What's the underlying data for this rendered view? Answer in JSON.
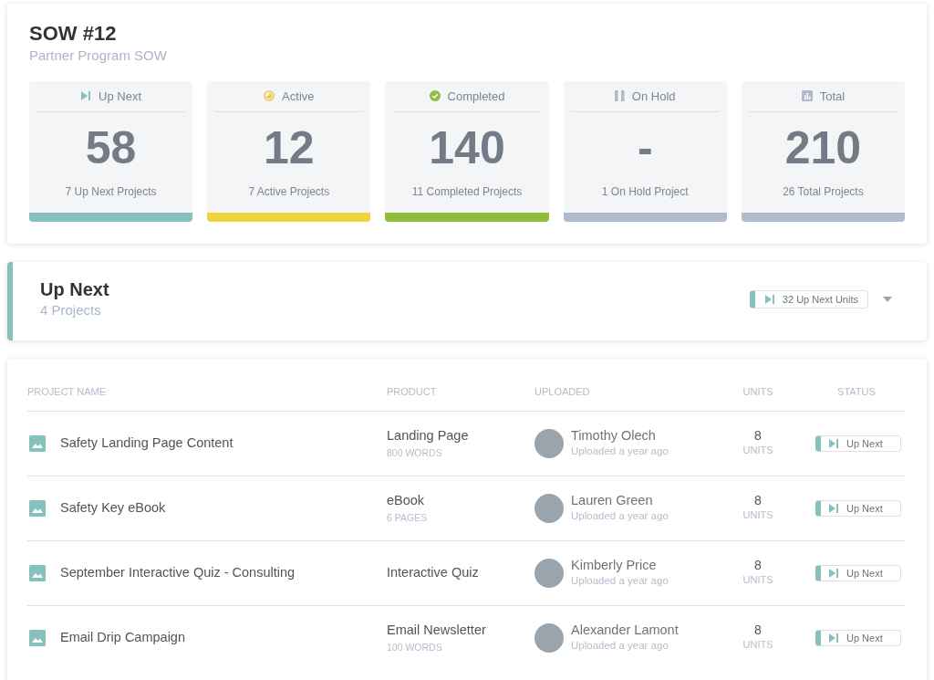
{
  "sow": {
    "title": "SOW #12",
    "subtitle": "Partner Program SOW"
  },
  "stats": [
    {
      "kind": "up-next",
      "label": "Up Next",
      "value": "58",
      "caption": "7 Up Next Projects",
      "color": "#86c2bd"
    },
    {
      "kind": "active",
      "label": "Active",
      "value": "12",
      "caption": "7 Active Projects",
      "color": "#f0d43a"
    },
    {
      "kind": "completed",
      "label": "Completed",
      "value": "140",
      "caption": "11 Completed Projects",
      "color": "#8fbe3b"
    },
    {
      "kind": "on-hold",
      "label": "On Hold",
      "value": "-",
      "caption": "1 On Hold Project",
      "color": "#b0bccb"
    },
    {
      "kind": "total",
      "label": "Total",
      "value": "210",
      "caption": "26 Total Projects",
      "color": "#b0bccb"
    }
  ],
  "section": {
    "title": "Up Next",
    "subtitle": "4 Projects",
    "units_badge": "32 Up Next Units",
    "kind": "up-next"
  },
  "table": {
    "columns": [
      "PROJECT NAME",
      "PRODUCT",
      "UPLOADED",
      "UNITS",
      "STATUS"
    ],
    "rows": [
      {
        "name": "Safety Landing Page Content",
        "product": "Landing Page",
        "product_detail": "800 WORDS",
        "uploader": "Timothy Olech",
        "uploaded": "Uploaded a year ago",
        "units": "8",
        "units_label": "UNITS",
        "status": "Up Next",
        "kind": "up-next"
      },
      {
        "name": "Safety Key eBook",
        "product": "eBook",
        "product_detail": "6 PAGES",
        "uploader": "Lauren Green",
        "uploaded": "Uploaded a year ago",
        "units": "8",
        "units_label": "UNITS",
        "status": "Up Next",
        "kind": "up-next"
      },
      {
        "name": "September Interactive Quiz - Consulting",
        "product": "Interactive Quiz",
        "uploader": "Kimberly Price",
        "uploaded": "Uploaded a year ago",
        "units": "8",
        "units_label": "UNITS",
        "status": "Up Next",
        "kind": "up-next"
      },
      {
        "name": "Email Drip Campaign",
        "product": "Email Newsletter",
        "product_detail": "100 WORDS",
        "uploader": "Alexander Lamont",
        "uploaded": "Uploaded a year ago",
        "units": "8",
        "units_label": "UNITS",
        "status": "Up Next",
        "kind": "up-next"
      }
    ]
  }
}
